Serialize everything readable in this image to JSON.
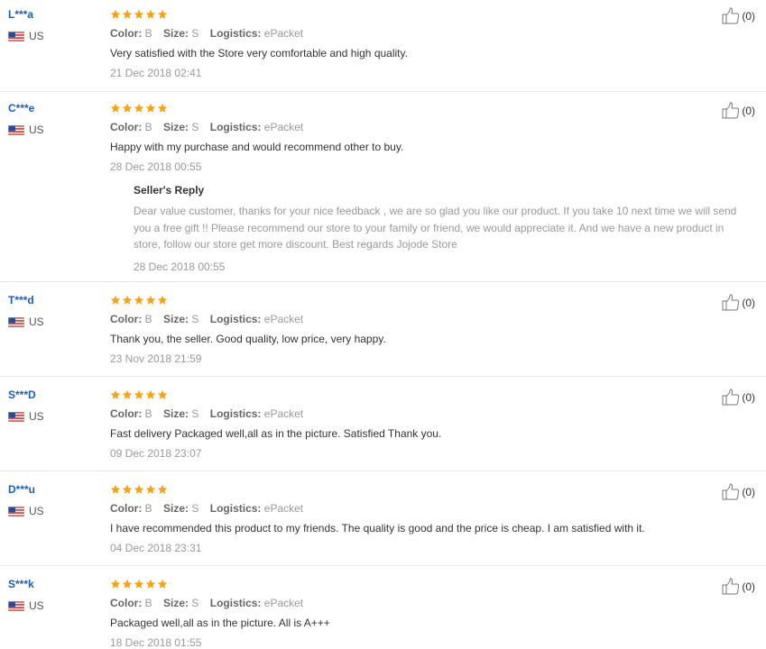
{
  "colors": {
    "star": "#f7a21b",
    "username": "#1a5eb8",
    "muted": "#999999",
    "divider": "#e6e6e6"
  },
  "labels": {
    "color": "Color:",
    "size": "Size:",
    "logistics": "Logistics:",
    "sellers_reply": "Seller's Reply"
  },
  "reviews": [
    {
      "user": "L***a",
      "country": "US",
      "stars": 5,
      "color": "B",
      "size": "S",
      "logistics": "ePacket",
      "text": "Very satisfied with the Store very comfortable and high quality.",
      "date": "21 Dec 2018 02:41",
      "helpful": "(0)"
    },
    {
      "user": "C***e",
      "country": "US",
      "stars": 5,
      "color": "B",
      "size": "S",
      "logistics": "ePacket",
      "text": "Happy with my purchase and would recommend other to buy.",
      "date": "28 Dec 2018 00:55",
      "helpful": "(0)",
      "reply": {
        "text": "Dear value customer, thanks for your nice feedback , we are so glad you like our product. If you take 10 next time we will send you a free gift !! Please recommend our store to your family or friend, we would appreciate it. And we have a new product in store, follow our store get more discount. Best regards Jojode Store",
        "date": "28 Dec 2018 00:55"
      }
    },
    {
      "user": "T***d",
      "country": "US",
      "stars": 5,
      "color": "B",
      "size": "S",
      "logistics": "ePacket",
      "text": "Thank you, the seller. Good quality, low price, very happy.",
      "date": "23 Nov 2018 21:59",
      "helpful": "(0)"
    },
    {
      "user": "S***D",
      "country": "US",
      "stars": 5,
      "color": "B",
      "size": "S",
      "logistics": "ePacket",
      "text": "Fast delivery Packaged well,all as in the picture. Satisfied Thank you.",
      "date": "09 Dec 2018 23:07",
      "helpful": "(0)"
    },
    {
      "user": "D***u",
      "country": "US",
      "stars": 5,
      "color": "B",
      "size": "S",
      "logistics": "ePacket",
      "text": "I have recommended this product to my friends. The quality is good and the price is cheap. I am satisfied with it.",
      "date": "04 Dec 2018 23:31",
      "helpful": "(0)"
    },
    {
      "user": "S***k",
      "country": "US",
      "stars": 5,
      "color": "B",
      "size": "S",
      "logistics": "ePacket",
      "text": "Packaged well,all as in the picture. All is A+++",
      "date": "18 Dec 2018 01:55",
      "helpful": "(0)"
    }
  ]
}
